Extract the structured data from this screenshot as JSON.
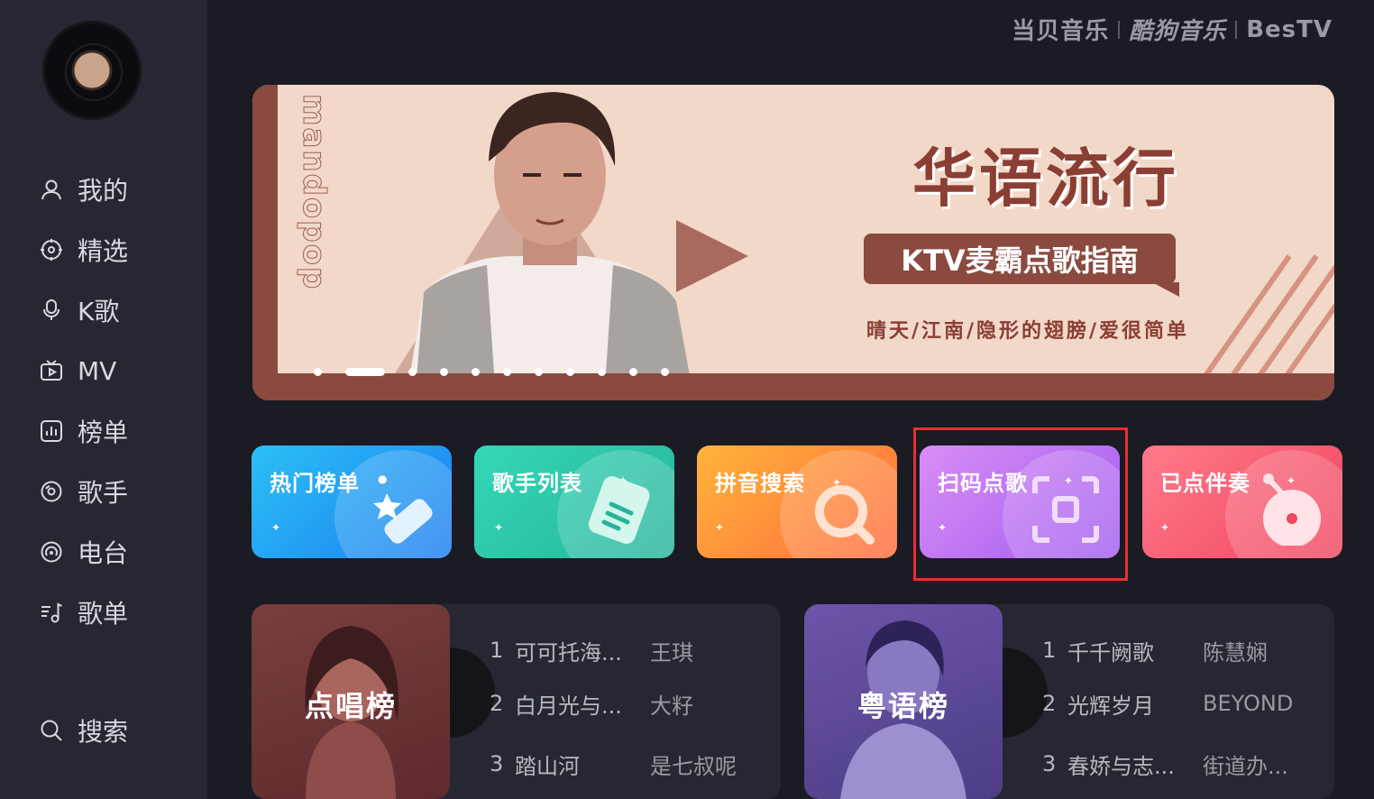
{
  "brand": {
    "dangbei": "当贝音乐",
    "kugou": "酷狗音乐",
    "bestv": "BesTV"
  },
  "nav": {
    "items": [
      {
        "label": "我的",
        "icon": "user-icon"
      },
      {
        "label": "精选",
        "icon": "compass-icon"
      },
      {
        "label": "K歌",
        "icon": "microphone-icon"
      },
      {
        "label": "MV",
        "icon": "tv-icon"
      },
      {
        "label": "榜单",
        "icon": "chart-icon"
      },
      {
        "label": "歌手",
        "icon": "disc-icon"
      },
      {
        "label": "电台",
        "icon": "radio-icon"
      },
      {
        "label": "歌单",
        "icon": "playlist-icon"
      }
    ],
    "search": "搜索"
  },
  "banner": {
    "title": "华语流行",
    "subtitle": "KTV麦霸点歌指南",
    "songs": "晴天/江南/隐形的翅膀/爱很简单",
    "vertical_text": "mandopop",
    "slide_count": 11,
    "active_slide": 1
  },
  "tiles": [
    {
      "label": "热门榜单",
      "icon": "star-icon",
      "color_from": "#2bc0f5",
      "color_to": "#1c7df0"
    },
    {
      "label": "歌手列表",
      "icon": "list-icon",
      "color_from": "#34d7b8",
      "color_to": "#27b49a"
    },
    {
      "label": "拼音搜索",
      "icon": "search-icon",
      "color_from": "#ffb43a",
      "color_to": "#ff6a3d"
    },
    {
      "label": "扫码点歌",
      "icon": "scan-icon",
      "color_from": "#d98df5",
      "color_to": "#a25cf0"
    },
    {
      "label": "已点伴奏",
      "icon": "record-icon",
      "color_from": "#ff7a8a",
      "color_to": "#f0455f"
    }
  ],
  "charts": [
    {
      "label": "点唱榜",
      "rows": [
        {
          "n": "1",
          "song": "可可托海...",
          "artist": "王琪"
        },
        {
          "n": "2",
          "song": "白月光与...",
          "artist": "大籽"
        },
        {
          "n": "3",
          "song": "踏山河",
          "artist": "是七叔呢"
        }
      ]
    },
    {
      "label": "粤语榜",
      "rows": [
        {
          "n": "1",
          "song": "千千阙歌",
          "artist": "陈慧娴"
        },
        {
          "n": "2",
          "song": "光辉岁月",
          "artist": "BEYOND"
        },
        {
          "n": "3",
          "song": "春娇与志...",
          "artist": "街道办..."
        }
      ]
    }
  ],
  "colors": {
    "highlight": "#e53030",
    "background": "#1a1b23",
    "sidebar": "#262732"
  }
}
